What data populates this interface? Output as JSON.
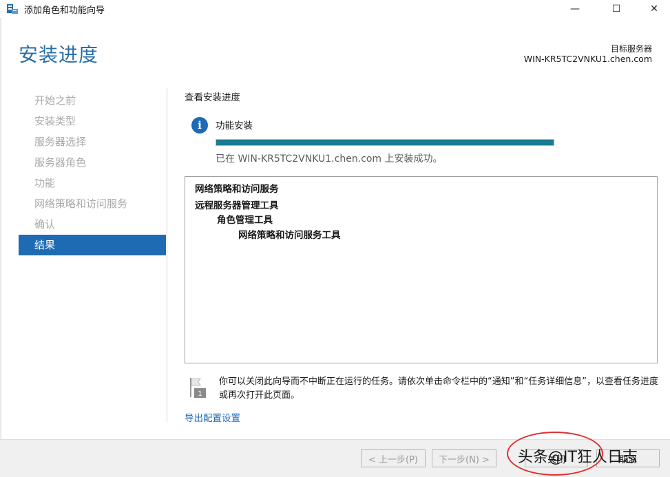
{
  "window": {
    "title": "添加角色和功能向导",
    "icon": "server-manager-icon",
    "controls": {
      "minimize": "—",
      "maximize": "☐",
      "close": "✕"
    }
  },
  "header": {
    "page_title": "安装进度",
    "target_label": "目标服务器",
    "target_value": "WIN-KR5TC2VNKU1.chen.com"
  },
  "nav": {
    "items": [
      {
        "label": "开始之前",
        "active": false
      },
      {
        "label": "安装类型",
        "active": false
      },
      {
        "label": "服务器选择",
        "active": false
      },
      {
        "label": "服务器角色",
        "active": false
      },
      {
        "label": "功能",
        "active": false
      },
      {
        "label": "网络策略和访问服务",
        "active": false
      },
      {
        "label": "确认",
        "active": false
      },
      {
        "label": "结果",
        "active": true
      }
    ]
  },
  "main": {
    "heading": "查看安装进度",
    "info_icon": "i",
    "feature_label": "功能安装",
    "progress_percent": 100,
    "accent_color": "#1a7b94",
    "status_text": "已在 WIN-KR5TC2VNKU1.chen.com 上安装成功。",
    "results": [
      {
        "label": "网络策略和访问服务",
        "level": 0
      },
      {
        "label": "远程服务器管理工具",
        "level": 0
      },
      {
        "label": "角色管理工具",
        "level": 1
      },
      {
        "label": "网络策略和访问服务工具",
        "level": 2
      }
    ],
    "note_badge": "1",
    "note_text": "你可以关闭此向导而不中断正在运行的任务。请依次单击命令栏中的“通知”和“任务详细信息”，以查看任务进度或再次打开此页面。",
    "export_link": "导出配置设置"
  },
  "footer": {
    "prev_label": "< 上一步(P)",
    "next_label": "下一步(N) >",
    "close_label": "关闭",
    "cancel_label": "取消"
  },
  "overlay": {
    "watermark": "头条@IT狂人日志"
  }
}
